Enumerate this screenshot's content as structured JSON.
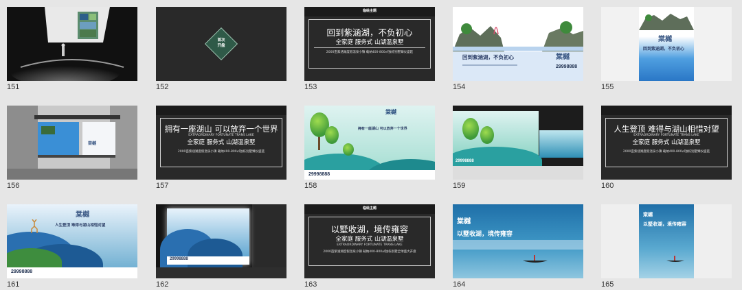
{
  "slides": [
    {
      "n": "151"
    },
    {
      "n": "152",
      "badge": "首次\n开盘"
    },
    {
      "n": "153",
      "bar": "临绘主题",
      "title": "回到紫涵湖，不负初心",
      "sub": "全家庭 服务式 山湖温泉墅",
      "small": "2000亩紫涵湖度假温泉小镇  载纳400-800㎡独栋别墅臻仪盛筵"
    },
    {
      "n": "154",
      "head": "回到紫涵湖，不负初心",
      "brand": "棠樾",
      "phone": "29998888"
    },
    {
      "n": "155",
      "brand": "棠樾",
      "head": "回到紫涵湖，不负初心"
    },
    {
      "n": "156",
      "brand": "棠樾"
    },
    {
      "n": "157",
      "title": "拥有一座湖山 可以放弃一个世界",
      "en": "EXTRAORDINARY FORTUNATE TRANS LAKE",
      "sub": "全家庭 服务式 山湖温泉墅",
      "small": "2000亩紫涵湖度假温泉小镇  载纳400-800㎡独栋别墅臻仪盛筵"
    },
    {
      "n": "158",
      "brand": "棠樾",
      "head": "拥有一座湖山 可以放弃一个世界",
      "phone": "29998888"
    },
    {
      "n": "159",
      "phone": "29998888"
    },
    {
      "n": "160",
      "title": "人生登顶 难得与湖山相惜对望",
      "en": "EXTRAORDINARY FORTUNATE TRANS LAKE",
      "sub": "全家庭 服务式 山湖温泉墅",
      "small": "2000亩紫涵湖度假温泉小镇  载纳400-800㎡独栋别墅臻仪盛筵"
    },
    {
      "n": "161",
      "brand": "棠樾",
      "head": "人生登顶 难得与湖山相惜对望",
      "phone": "29998888"
    },
    {
      "n": "162",
      "phone": "29998888"
    },
    {
      "n": "163",
      "bar": "临绘主题",
      "title": "以墅收湖，境传雍容",
      "en": "EXTRAORDINARY FORTUNATE TRANS LAKE",
      "sub": "全家庭 服务式 山湖温泉墅",
      "small": "2000亩紫涵湖度假温泉小镇  载纳400-800㎡独栋别墅全球盛大开盘"
    },
    {
      "n": "164",
      "brand": "棠樾",
      "head": "以墅收湖，境传雍容"
    },
    {
      "n": "165",
      "brand": "棠樾",
      "head": "以墅收湖，境传雍容"
    }
  ],
  "colors": {
    "dark_slide": "#292929",
    "panel_bg": "#e6e6e6",
    "brand_blue": "#3d5a86"
  }
}
